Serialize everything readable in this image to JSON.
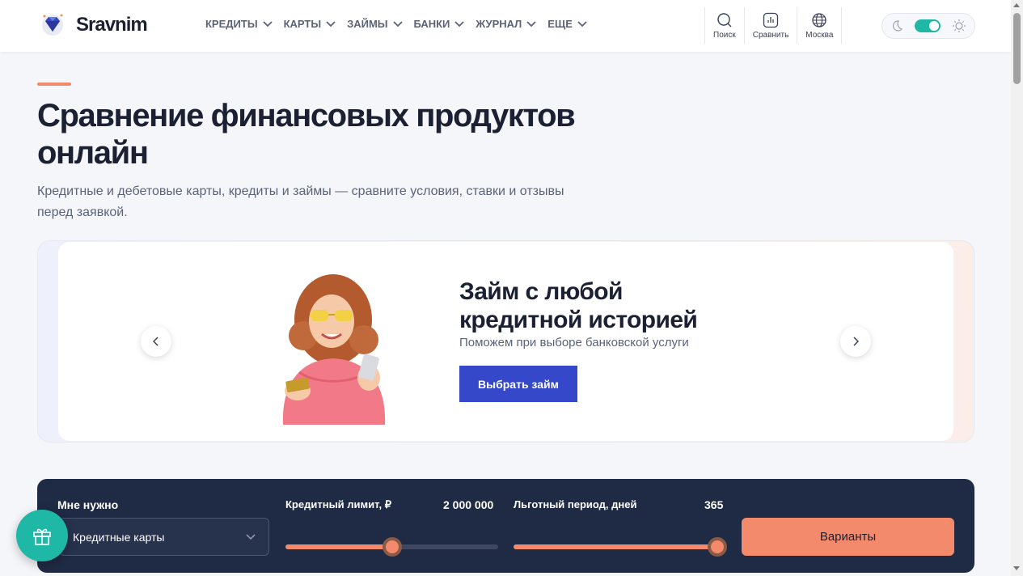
{
  "header": {
    "brand": "Sravnim",
    "nav": [
      {
        "label": "КРЕДИТЫ"
      },
      {
        "label": "КАРТЫ"
      },
      {
        "label": "ЗАЙМЫ"
      },
      {
        "label": "БАНКИ"
      },
      {
        "label": "ЖУРНАЛ"
      },
      {
        "label": "ЕЩЕ"
      }
    ],
    "tools": {
      "search": "Поиск",
      "compare": "Сравнить",
      "city": "Москва"
    },
    "theme_toggle": {
      "state": "on"
    }
  },
  "hero": {
    "title": "Сравнение финансовых продуктов онлайн",
    "subtitle": "Кредитные и дебетовые карты, кредиты и займы — сравните условия, ставки и отзывы перед заявкой."
  },
  "banner": {
    "title": "Займ с любой кредитной историей",
    "subtitle": "Поможем при выборе банковской услуги",
    "button": "Выбрать займ"
  },
  "filter": {
    "need_label": "Мне нужно",
    "need_value": "Кредитные карты",
    "limit_label": "Кредитный лимит, ₽",
    "limit_value": "2 000 000",
    "limit_fraction": 0.5,
    "grace_label": "Льготный период, дней",
    "grace_value": "365",
    "grace_fraction": 1.0,
    "button": "Варианты"
  },
  "colors": {
    "accent": "#f28a6b",
    "primary": "#3548c9",
    "panel": "#1f2a44",
    "teal": "#1fb7a6"
  }
}
